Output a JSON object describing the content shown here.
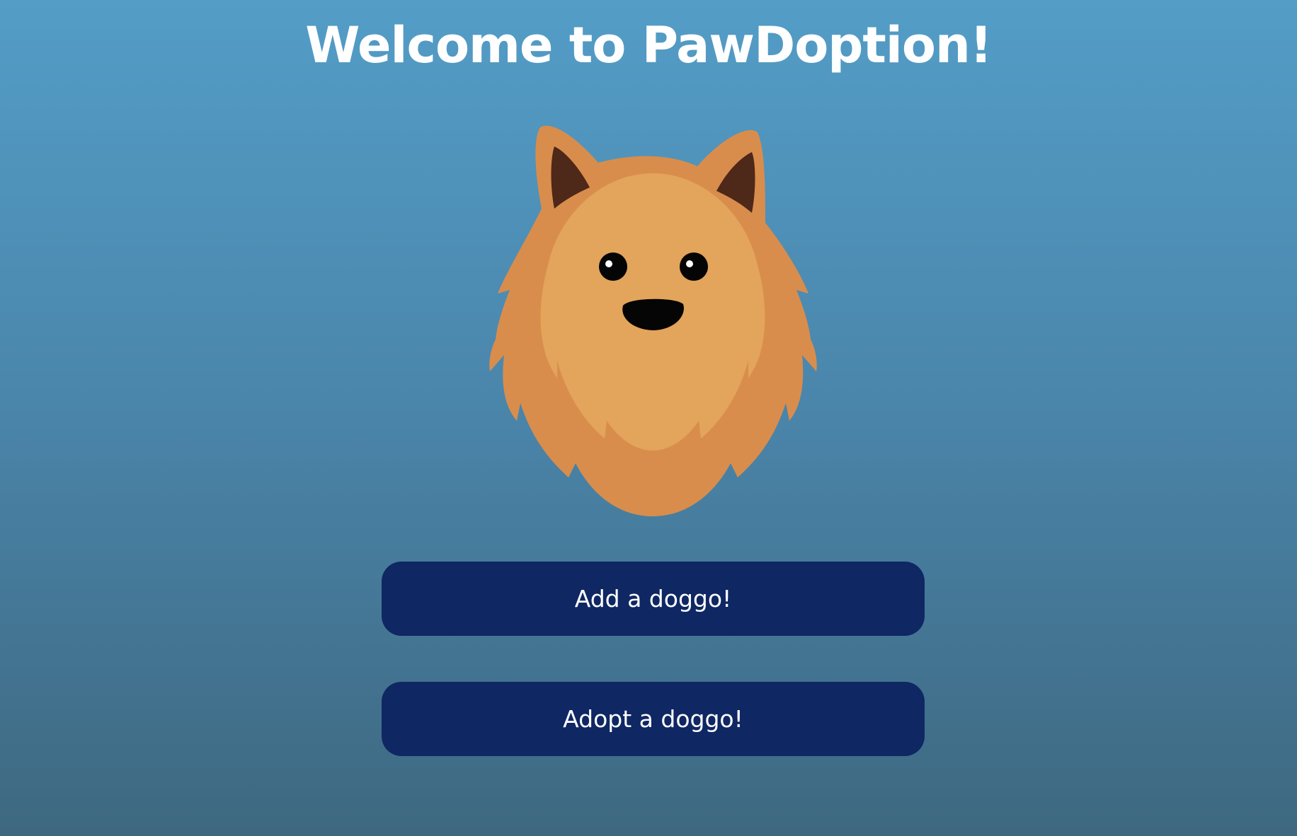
{
  "header": {
    "title": "Welcome to PawDoption!"
  },
  "mascot": {
    "icon": "dog-face-icon",
    "colors": {
      "outer_fur": "#d98d4c",
      "inner_fur": "#e3a45b",
      "ear_inner": "#4e2819",
      "eyes_nose": "#050505"
    }
  },
  "actions": {
    "add_label": "Add a doggo!",
    "adopt_label": "Adopt a doggo!"
  },
  "theme": {
    "background_top": "#539dc7",
    "background_bottom": "#3e6880",
    "button_color": "#0f2763",
    "text_color": "#ffffff"
  }
}
